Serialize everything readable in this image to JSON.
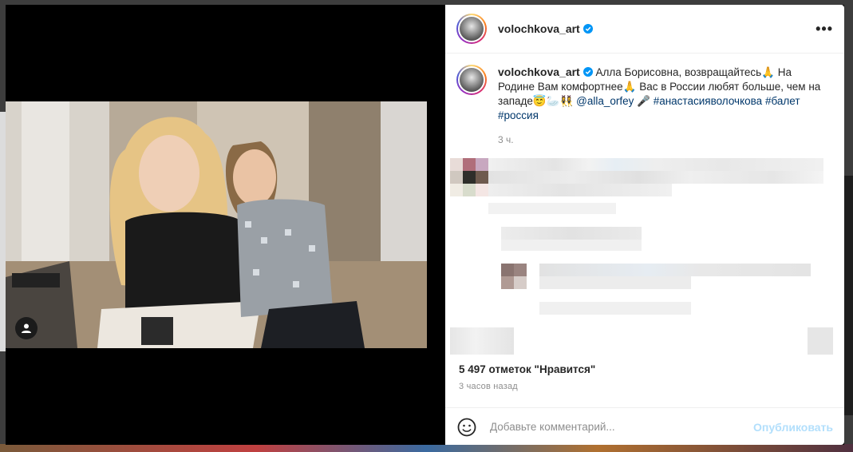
{
  "post": {
    "username": "volochkova_art",
    "caption_main": "Алла Борисовна, возвращайтесь🙏 На Родине Вам комфортнее🙏 Вас в России любят больше, чем на западе😇🦢👯‍♀️",
    "mention": "@alla_orfey",
    "caption_mid": "🎤",
    "hashtags": [
      "#анастасияволочкова",
      "#балет",
      "#россия"
    ],
    "time_short": "3 ч.",
    "likes": "5 497 отметок \"Нравится\"",
    "time_long": "3 часов назад"
  },
  "comment_bar": {
    "placeholder": "Добавьте комментарий...",
    "post_label": "Опубликовать"
  },
  "icons": {
    "verified": "verified-badge-icon",
    "more": "more-options-icon",
    "emoji": "emoji-icon",
    "user_tag": "user-tag-icon"
  },
  "colors": {
    "link": "#00376b",
    "verified": "#0095f6",
    "post_button_disabled": "#b2dffc"
  }
}
